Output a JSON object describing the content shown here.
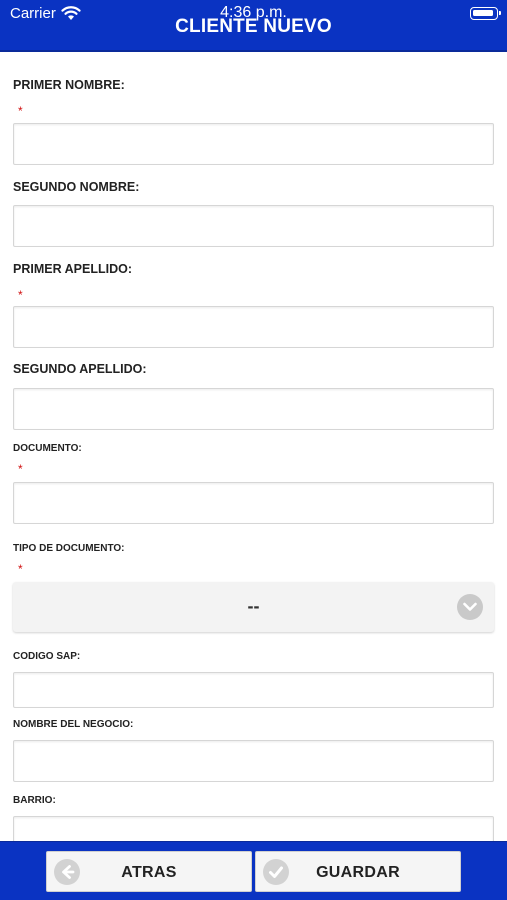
{
  "status_bar": {
    "carrier": "Carrier",
    "time": "4:36 p.m."
  },
  "header": {
    "title": "CLIENTE NUEVO"
  },
  "colors": {
    "brand_blue": "#0a33c2",
    "required_red": "#d01010"
  },
  "form": {
    "required_marker": "*",
    "fields": {
      "primer_nombre": {
        "label": "PRIMER NOMBRE:",
        "value": "",
        "required": true
      },
      "segundo_nombre": {
        "label": "SEGUNDO NOMBRE:",
        "value": "",
        "required": false
      },
      "primer_apellido": {
        "label": "PRIMER APELLIDO:",
        "value": "",
        "required": true
      },
      "segundo_apellido": {
        "label": "SEGUNDO APELLIDO:",
        "value": "",
        "required": false
      },
      "documento": {
        "label": "DOCUMENTO:",
        "value": "",
        "required": true
      },
      "tipo_documento": {
        "label": "TIPO DE DOCUMENTO:",
        "selected": "--",
        "required": true
      },
      "codigo_sap": {
        "label": "CODIGO SAP:",
        "value": "",
        "required": false
      },
      "nombre_negocio": {
        "label": "NOMBRE DEL NEGOCIO:",
        "value": "",
        "required": false
      },
      "barrio": {
        "label": "BARRIO:",
        "value": "",
        "required": false
      }
    }
  },
  "footer": {
    "back_label": "ATRAS",
    "save_label": "GUARDAR",
    "back_icon": "arrow-left-circle-icon",
    "save_icon": "check-circle-icon"
  }
}
